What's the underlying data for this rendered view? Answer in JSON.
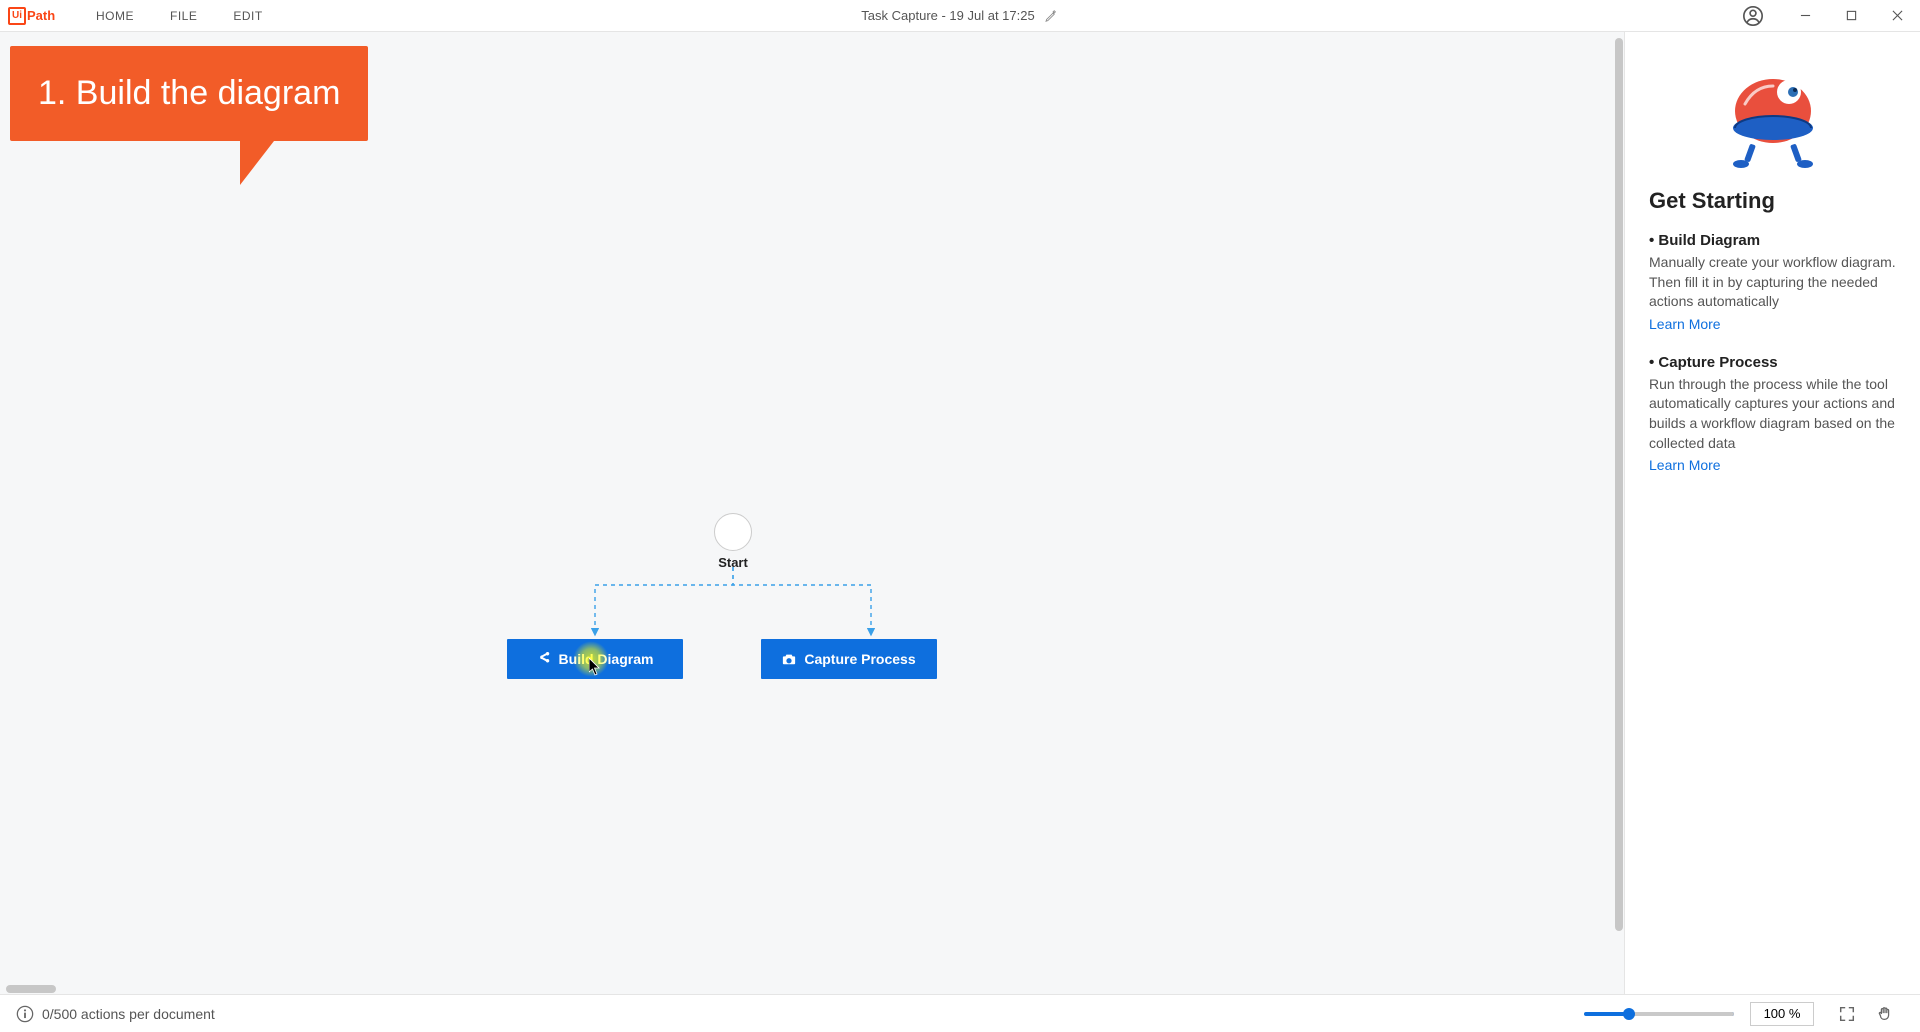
{
  "app": {
    "logo_ui": "Ui",
    "logo_path": "Path",
    "title": "Task Capture - 19 Jul at 17:25"
  },
  "menu": {
    "home": "HOME",
    "file": "FILE",
    "edit": "EDIT"
  },
  "callout": {
    "text": "1. Build the diagram"
  },
  "diagram": {
    "start_label": "Start",
    "build_label": "Build Diagram",
    "capture_label": "Capture Process"
  },
  "side": {
    "title": "Get Starting",
    "sections": [
      {
        "title": "• Build Diagram",
        "body": "Manually create your workflow diagram. Then fill it in by capturing the needed actions automatically",
        "link": "Learn More"
      },
      {
        "title": "• Capture Process",
        "body": "Run through the process while the tool automatically captures your actions and builds a workflow diagram based on the collected data",
        "link": "Learn More"
      }
    ]
  },
  "status": {
    "actions": "0/500 actions per document",
    "zoom": "100 %"
  },
  "colors": {
    "brand_orange": "#fa4616",
    "callout_orange": "#f25c28",
    "primary_blue": "#0e6fde"
  }
}
